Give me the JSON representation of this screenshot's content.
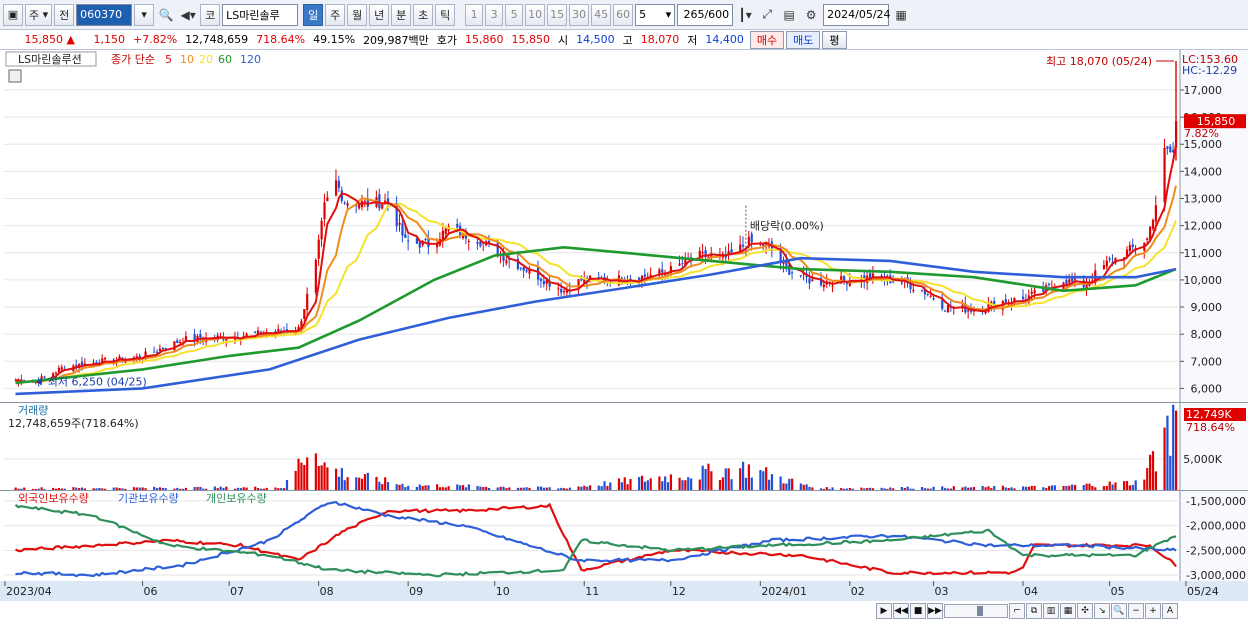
{
  "toolbar": {
    "period_select": "주",
    "prev_label": "전",
    "stock_code": "060370",
    "stock_name_button": "코",
    "stock_name": "LS마린솔루",
    "period_tabs": [
      "일",
      "주",
      "월",
      "년",
      "분",
      "초",
      "틱"
    ],
    "active_period": "일",
    "interval_buttons": [
      "1",
      "3",
      "5",
      "10",
      "15",
      "30",
      "45",
      "60"
    ],
    "interval_value": "5",
    "bar_count": "265",
    "bar_total": "/600",
    "date": "2024/05/24"
  },
  "quote": {
    "price": "15,850",
    "change_arrow": "▲",
    "change": "1,150",
    "change_pct": "+7.82%",
    "volume": "12,748,659",
    "volume_ratio": "718.64%",
    "turnover_ratio": "49.15%",
    "amount": "209,987백만",
    "ask_label": "호가",
    "ask": "15,860",
    "bid": "15,850",
    "open_label": "시",
    "open": "14,500",
    "high_label": "고",
    "high": "18,070",
    "low_label": "저",
    "low": "14,400",
    "buy_button": "매수",
    "sell_button": "매도",
    "avg_button": "평"
  },
  "colors": {
    "up": "#e00000",
    "down": "#1f4fd8",
    "ma5": "#e01010",
    "ma10": "#f08c1a",
    "ma20": "#f5e22a",
    "ma60": "#1f9a2e",
    "ma120": "#2f5fd8",
    "foreign": "#e01010",
    "institution": "#2f5fd8",
    "individual": "#2f8f5a",
    "grid": "#e6e6e6",
    "axis_bg": "#dce8f6"
  },
  "chart_data": [
    {
      "type": "candlestick",
      "title": "LS마린솔루션",
      "legend": {
        "price_label": "종가 단순",
        "ma_periods": [
          "5",
          "10",
          "20",
          "60",
          "120"
        ]
      },
      "ylim": [
        5500,
        18400
      ],
      "y_ticks": [
        "6,000",
        "7,000",
        "8,000",
        "9,000",
        "10,000",
        "11,000",
        "12,000",
        "13,000",
        "14,000",
        "15,000",
        "16,000",
        "17,000"
      ],
      "x_ticks": [
        "2023/04",
        "06",
        "07",
        "08",
        "09",
        "10",
        "11",
        "12",
        "2024/01",
        "02",
        "03",
        "04",
        "05",
        "05/24"
      ],
      "approx_close_path": [
        [
          "2023/04/18",
          6300
        ],
        [
          "2023/04/25",
          6250
        ],
        [
          "2023/05/05",
          6800
        ],
        [
          "2023/05/18",
          7000
        ],
        [
          "2023/05/31",
          7150
        ],
        [
          "2023/06/15",
          7800
        ],
        [
          "2023/06/30",
          7900
        ],
        [
          "2023/07/15",
          8050
        ],
        [
          "2023/07/25",
          8200
        ],
        [
          "2023/07/27",
          9000
        ],
        [
          "2023/07/31",
          10600
        ],
        [
          "2023/08/03",
          12700
        ],
        [
          "2023/08/07",
          13600
        ],
        [
          "2023/08/10",
          12900
        ],
        [
          "2023/08/18",
          12800
        ],
        [
          "2023/08/25",
          12900
        ],
        [
          "2023/08/31",
          11400
        ],
        [
          "2023/09/08",
          11300
        ],
        [
          "2023/09/15",
          11900
        ],
        [
          "2023/09/25",
          11500
        ],
        [
          "2023/10/05",
          10800
        ],
        [
          "2023/10/15",
          10200
        ],
        [
          "2023/10/25",
          9600
        ],
        [
          "2023/10/31",
          10000
        ],
        [
          "2023/11/10",
          10000
        ],
        [
          "2023/11/20",
          10100
        ],
        [
          "2023/11/30",
          10300
        ],
        [
          "2023/12/10",
          10900
        ],
        [
          "2023/12/20",
          10800
        ],
        [
          "2023/12/28",
          11400
        ],
        [
          "2024/01/04",
          11200
        ],
        [
          "2024/01/10",
          10400
        ],
        [
          "2024/01/20",
          9900
        ],
        [
          "2024/01/31",
          10000
        ],
        [
          "2024/02/10",
          10100
        ],
        [
          "2024/02/20",
          9900
        ],
        [
          "2024/02/28",
          9500
        ],
        [
          "2024/03/05",
          9000
        ],
        [
          "2024/03/15",
          8900
        ],
        [
          "2024/03/25",
          9200
        ],
        [
          "2024/04/01",
          9300
        ],
        [
          "2024/04/08",
          9600
        ],
        [
          "2024/04/15",
          10000
        ],
        [
          "2024/04/22",
          9800
        ],
        [
          "2024/04/30",
          10600
        ],
        [
          "2024/05/08",
          11100
        ],
        [
          "2024/05/14",
          11500
        ],
        [
          "2024/05/17",
          12800
        ],
        [
          "2024/05/20",
          14700
        ],
        [
          "2024/05/22",
          14700
        ],
        [
          "2024/05/23",
          14700
        ],
        [
          "2024/05/24",
          15850
        ]
      ],
      "approx_ma60_path": [
        [
          "2023/04/18",
          6200
        ],
        [
          "2023/06/01",
          6700
        ],
        [
          "2023/07/01",
          7200
        ],
        [
          "2023/07/25",
          7500
        ],
        [
          "2023/08/15",
          8500
        ],
        [
          "2023/09/10",
          10000
        ],
        [
          "2023/10/01",
          10900
        ],
        [
          "2023/10/25",
          11200
        ],
        [
          "2023/11/15",
          11000
        ],
        [
          "2023/12/15",
          10700
        ],
        [
          "2024/01/15",
          10400
        ],
        [
          "2024/02/15",
          10300
        ],
        [
          "2024/03/15",
          10100
        ],
        [
          "2024/04/15",
          9600
        ],
        [
          "2024/05/10",
          9800
        ],
        [
          "2024/05/24",
          10400
        ]
      ],
      "approx_ma120_path": [
        [
          "2023/04/18",
          5800
        ],
        [
          "2023/06/01",
          6000
        ],
        [
          "2023/07/15",
          6700
        ],
        [
          "2023/08/15",
          7800
        ],
        [
          "2023/09/15",
          8600
        ],
        [
          "2023/10/15",
          9200
        ],
        [
          "2023/11/15",
          9700
        ],
        [
          "2023/12/15",
          10200
        ],
        [
          "2024/01/15",
          10800
        ],
        [
          "2024/02/15",
          10700
        ],
        [
          "2024/03/15",
          10300
        ],
        [
          "2024/04/15",
          10100
        ],
        [
          "2024/05/10",
          10100
        ],
        [
          "2024/05/24",
          10400
        ]
      ],
      "annotations": [
        {
          "text": "최고 18,070 (05/24)",
          "date": "2024/05/24",
          "value": 18070
        },
        {
          "text": "최저 6,250 (04/25)",
          "date": "2023/04/25",
          "value": 6250
        },
        {
          "text": "배당락(0.00%)",
          "date": "2023/12/27",
          "value": 12000
        }
      ],
      "right_labels": {
        "lc": "LC:153.60",
        "hc": "HC:-12.29",
        "last_price": "15,850",
        "last_pct": "7.82%"
      }
    },
    {
      "type": "bar",
      "title": "거래량",
      "value_label": "12,748,659주(718.64%)",
      "y_ticks": [
        "5,000K"
      ],
      "ylim": [
        0,
        13000000
      ],
      "last_label": "12,749K",
      "last_pct": "718.64%",
      "approx_volume_path": [
        [
          "2023/04/18",
          300000
        ],
        [
          "2023/07/20",
          400000
        ],
        [
          "2023/07/31",
          8500000
        ],
        [
          "2023/08/02",
          4000000
        ],
        [
          "2023/08/10",
          2500000
        ],
        [
          "2023/08/31",
          800000
        ],
        [
          "2023/10/25",
          300000
        ],
        [
          "2023/12/27",
          3500000
        ],
        [
          "2024/01/20",
          300000
        ],
        [
          "2024/04/10",
          500000
        ],
        [
          "2024/05/10",
          1200000
        ],
        [
          "2024/05/17",
          5500000
        ],
        [
          "2024/05/20",
          12500000
        ],
        [
          "2024/05/22",
          6500000
        ],
        [
          "2024/05/23",
          12000000
        ],
        [
          "2024/05/24",
          12748659
        ]
      ]
    },
    {
      "type": "line",
      "series_names": [
        "외국인보유수량",
        "기관보유수량",
        "개인보유수량"
      ],
      "y_ticks": [
        "-1,500,000",
        "-2,000,000",
        "-2,500,000",
        "-3,000,000"
      ],
      "ylim": [
        -3100000,
        -1300000
      ],
      "series": [
        {
          "name": "외국인보유수량",
          "values": [
            [
              "2023/04/18",
              -2500000
            ],
            [
              "2023/05/15",
              -2400000
            ],
            [
              "2023/06/10",
              -2300000
            ],
            [
              "2023/07/05",
              -2400000
            ],
            [
              "2023/07/25",
              -2700000
            ],
            [
              "2023/08/10",
              -2100000
            ],
            [
              "2023/08/25",
              -1700000
            ],
            [
              "2023/09/20",
              -1700000
            ],
            [
              "2023/10/20",
              -1600000
            ],
            [
              "2023/10/31",
              -2900000
            ],
            [
              "2023/12/01",
              -2500000
            ],
            [
              "2024/01/15",
              -2600000
            ],
            [
              "2024/02/15",
              -2950000
            ],
            [
              "2024/03/31",
              -2950000
            ],
            [
              "2024/04/05",
              -2400000
            ],
            [
              "2024/05/15",
              -2400000
            ],
            [
              "2024/05/24",
              -2800000
            ]
          ]
        },
        {
          "name": "기관보유수량",
          "values": [
            [
              "2023/04/18",
              -2950000
            ],
            [
              "2023/05/15",
              -3000000
            ],
            [
              "2023/06/15",
              -2800000
            ],
            [
              "2023/07/15",
              -2300000
            ],
            [
              "2023/08/05",
              -1500000
            ],
            [
              "2023/08/25",
              -1800000
            ],
            [
              "2023/09/20",
              -2000000
            ],
            [
              "2023/10/30",
              -2700000
            ],
            [
              "2023/12/01",
              -2700000
            ],
            [
              "2024/01/05",
              -2300000
            ],
            [
              "2024/02/15",
              -2200000
            ],
            [
              "2024/03/20",
              -2400000
            ],
            [
              "2024/04/20",
              -2400000
            ],
            [
              "2024/05/24",
              -2500000
            ]
          ]
        },
        {
          "name": "개인보유수량",
          "values": [
            [
              "2023/04/18",
              -1600000
            ],
            [
              "2023/05/15",
              -1800000
            ],
            [
              "2023/06/10",
              -2400000
            ],
            [
              "2023/07/15",
              -2600000
            ],
            [
              "2023/08/05",
              -2900000
            ],
            [
              "2023/09/10",
              -3000000
            ],
            [
              "2023/10/25",
              -2900000
            ],
            [
              "2023/10/31",
              -2300000
            ],
            [
              "2023/12/01",
              -2500000
            ],
            [
              "2024/01/05",
              -2400000
            ],
            [
              "2024/02/15",
              -2300000
            ],
            [
              "2024/03/20",
              -2100000
            ],
            [
              "2024/04/01",
              -2600000
            ],
            [
              "2024/05/10",
              -2600000
            ],
            [
              "2024/05/24",
              -2200000
            ]
          ]
        }
      ]
    }
  ]
}
